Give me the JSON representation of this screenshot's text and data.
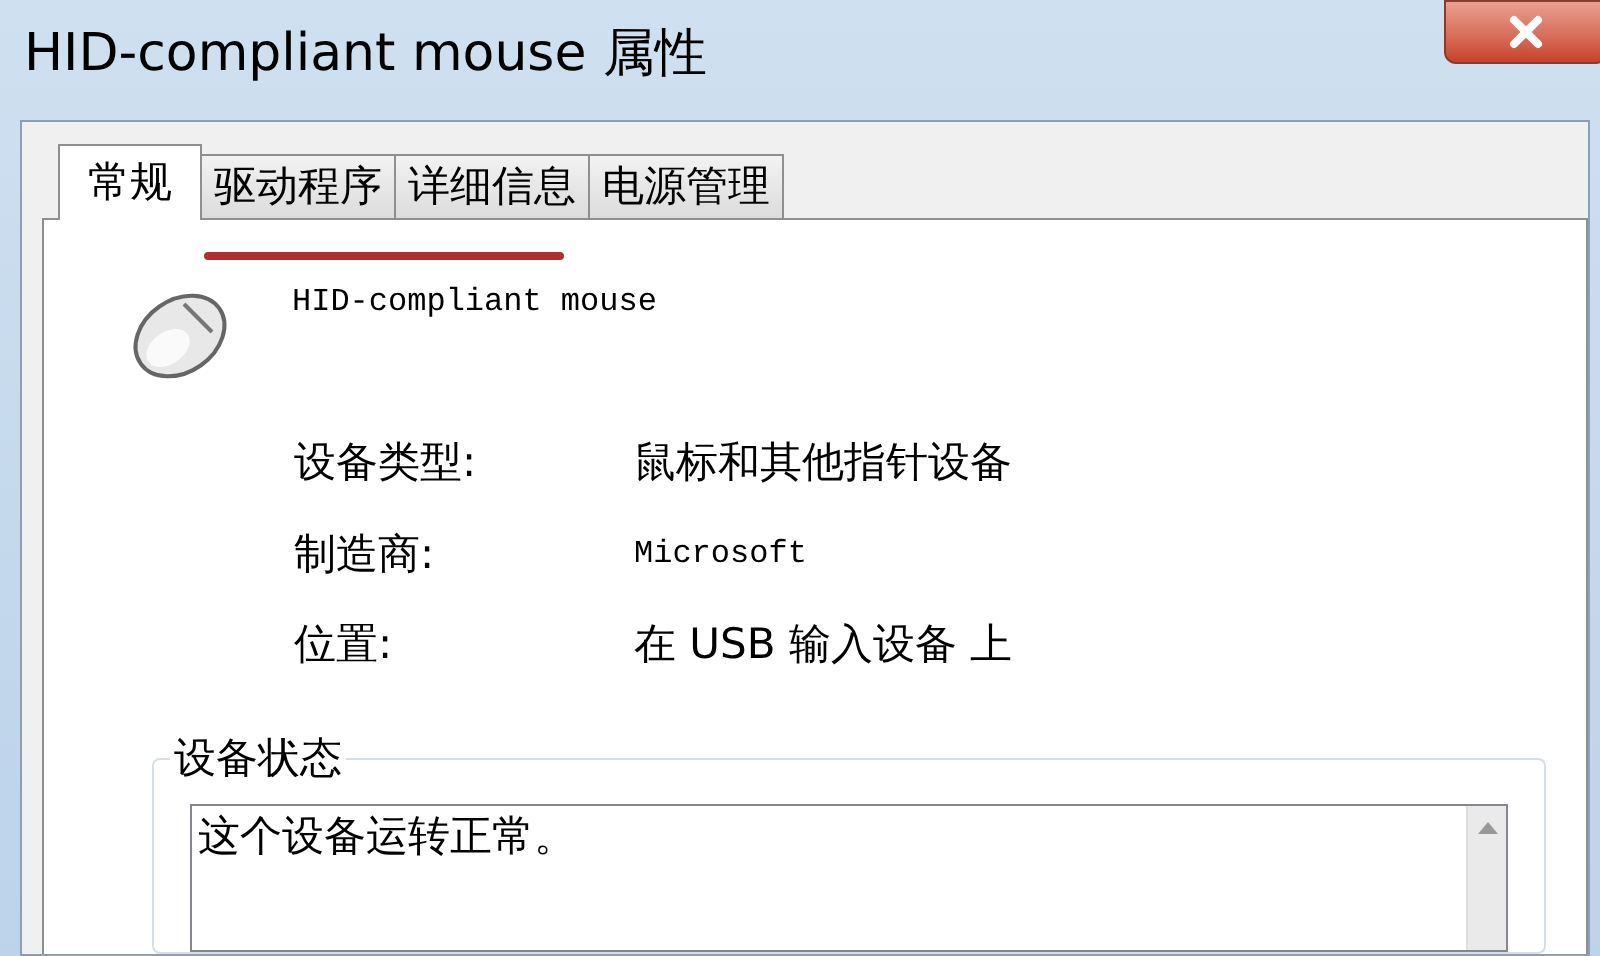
{
  "window": {
    "title": "HID-compliant mouse 属性"
  },
  "tabs": [
    {
      "label": "常规",
      "selected": true
    },
    {
      "label": "驱动程序",
      "selected": false
    },
    {
      "label": "详细信息",
      "selected": false
    },
    {
      "label": "电源管理",
      "selected": false
    }
  ],
  "device": {
    "name": "HID-compliant mouse"
  },
  "properties": [
    {
      "label": "设备类型:",
      "value": "鼠标和其他指针设备",
      "kind": "cjk"
    },
    {
      "label": "制造商:",
      "value": "Microsoft",
      "kind": "mono"
    },
    {
      "label": "位置:",
      "value": "在 USB 输入设备 上",
      "kind": "cjk"
    }
  ],
  "status": {
    "title": "设备状态",
    "text": "这个设备运转正常。"
  }
}
